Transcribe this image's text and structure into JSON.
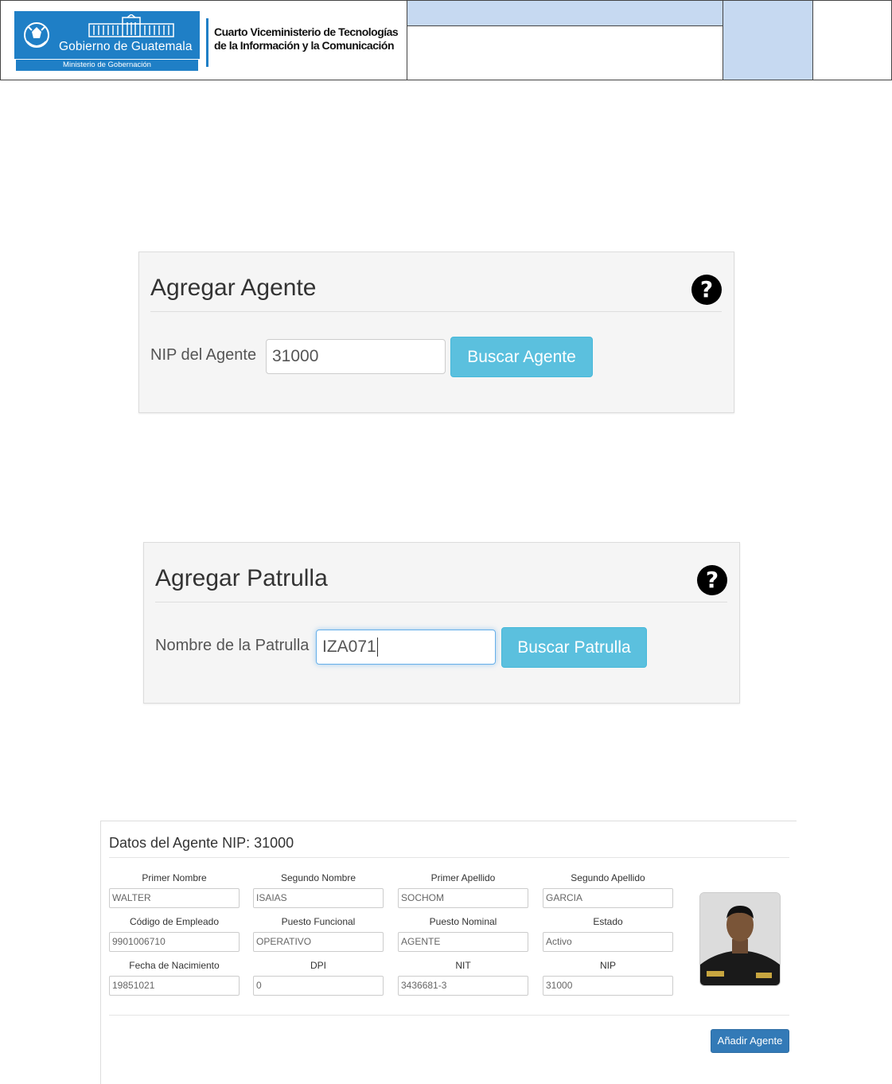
{
  "header": {
    "logo_name": "Gobierno de Guatemala",
    "logo_ministry": "Ministerio de Gobernación",
    "org_line1": "Cuarto Viceministerio de Tecnologías",
    "org_line2": "de la Información y la Comunicación",
    "accent_color": "#1f7fc6",
    "cell_color": "#c6d9f1"
  },
  "agent_search": {
    "title": "Agregar Agente",
    "help_icon": "?",
    "label": "NIP del Agente",
    "value": "31000",
    "button": "Buscar Agente"
  },
  "patrol_search": {
    "title": "Agregar Patrulla",
    "help_icon": "?",
    "label": "Nombre de la Patrulla",
    "value": "IZA071",
    "button": "Buscar Patrulla"
  },
  "agent_data": {
    "title": "Datos del Agente NIP: 31000",
    "fields": [
      {
        "label": "Primer Nombre",
        "value": "WALTER"
      },
      {
        "label": "Segundo Nombre",
        "value": "ISAIAS"
      },
      {
        "label": "Primer Apellido",
        "value": "SOCHOM"
      },
      {
        "label": "Segundo Apellido",
        "value": "GARCIA"
      },
      {
        "label": "Código de Empleado",
        "value": "9901006710"
      },
      {
        "label": "Puesto Funcional",
        "value": "OPERATIVO"
      },
      {
        "label": "Puesto Nominal",
        "value": "AGENTE"
      },
      {
        "label": "Estado",
        "value": "Activo"
      },
      {
        "label": "Fecha de Nacimiento",
        "value": "19851021"
      },
      {
        "label": "DPI",
        "value": "0"
      },
      {
        "label": "NIT",
        "value": "3436681-3"
      },
      {
        "label": "NIP",
        "value": "31000"
      }
    ],
    "add_button": "Añadir Agente",
    "button_color": "#337ab7",
    "info_button_color": "#5bc0de"
  }
}
